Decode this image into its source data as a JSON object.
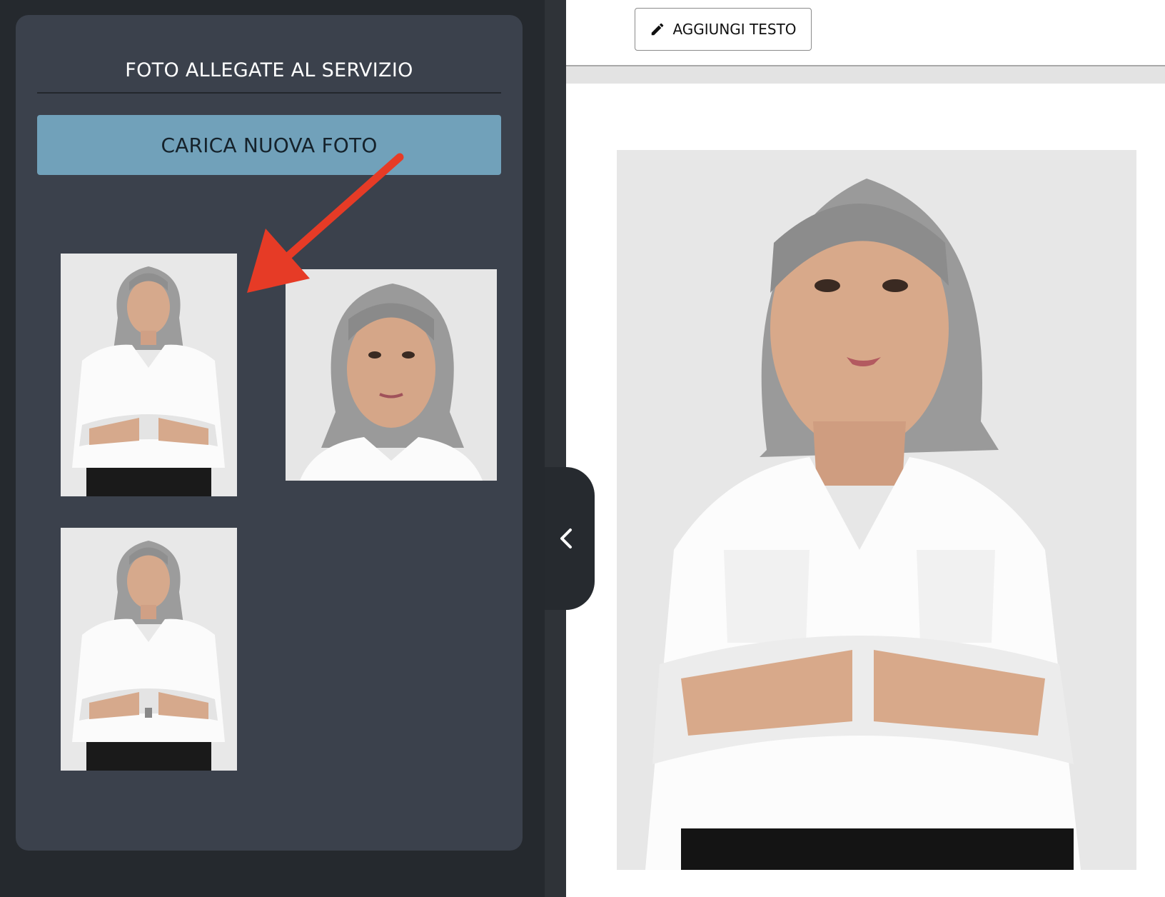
{
  "sidebar": {
    "title": "FOTO ALLEGATE AL SERVIZIO",
    "upload_button": "CARICA NUOVA FOTO",
    "photos": [
      {
        "name": "photo-thumbnail-1",
        "icon": "portrait-full-body"
      },
      {
        "name": "photo-thumbnail-2",
        "icon": "portrait-headshot"
      },
      {
        "name": "photo-thumbnail-3",
        "icon": "portrait-full-body"
      }
    ]
  },
  "toolbar": {
    "add_text_button": "AGGIUNGI TESTO",
    "add_text_icon": "pencil-icon"
  },
  "collapse_tab": {
    "icon": "chevron-left-icon"
  },
  "colors": {
    "panel_bg": "#3b414c",
    "upload_button": "#71a1ba",
    "annotation_arrow": "#e63b26"
  }
}
